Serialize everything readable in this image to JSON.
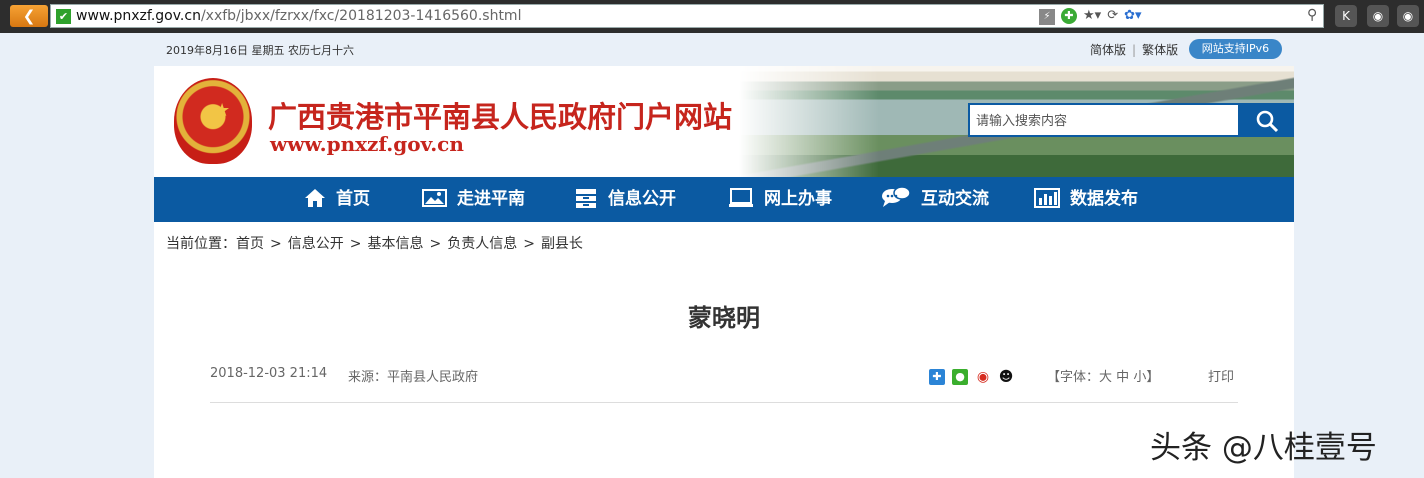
{
  "browser": {
    "url_host": "www.pnxzf.gov.cn",
    "url_path": "/xxfb/jbxx/fzrxx/fxc/20181203-1416560.shtml",
    "right_buttons": [
      "K",
      "🔒",
      "🔒"
    ]
  },
  "topbar": {
    "date": "2019年8月16日 星期五 农历七月十六",
    "simplified": "简体版",
    "separator": "|",
    "traditional": "繁体版",
    "ipv6": "网站支持IPv6"
  },
  "header": {
    "title": "广西贵港市平南县人民政府门户网站",
    "domain": "www.pnxzf.gov.cn",
    "search_placeholder": "请输入搜索内容"
  },
  "nav": {
    "items": [
      {
        "label": "首页",
        "icon": "home-icon"
      },
      {
        "label": "走进平南",
        "icon": "image-icon"
      },
      {
        "label": "信息公开",
        "icon": "archive-icon"
      },
      {
        "label": "网上办事",
        "icon": "monitor-icon"
      },
      {
        "label": "互动交流",
        "icon": "chat-icon"
      },
      {
        "label": "数据发布",
        "icon": "bar-chart-icon"
      }
    ]
  },
  "breadcrumb": {
    "prefix": "当前位置：",
    "items": [
      "首页",
      "信息公开",
      "基本信息",
      "负责人信息",
      "副县长"
    ],
    "separator": ">"
  },
  "article": {
    "title": "蒙晓明",
    "date": "2018-12-03 21:14",
    "source": "来源：平南县人民政府",
    "share_icons": [
      "share-plus-icon",
      "wechat-icon",
      "weibo-icon",
      "qq-icon"
    ],
    "font_open": "【字体：",
    "font_large": "大",
    "font_medium": "中",
    "font_small": "小",
    "font_close": "】",
    "print": "打印"
  },
  "watermark": "头条 @八桂壹号",
  "colors": {
    "nav_blue": "#0b5aa2",
    "title_red": "#c6251d",
    "ipv6_badge": "#3a86c8"
  }
}
